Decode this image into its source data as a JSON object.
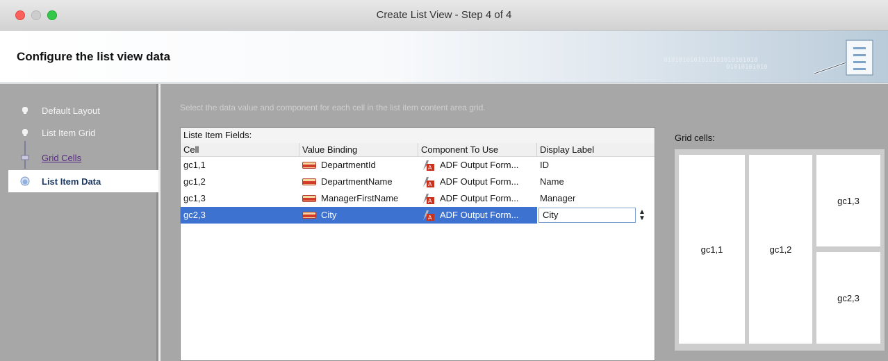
{
  "window": {
    "title": "Create List View - Step 4 of 4"
  },
  "header": {
    "title": "Configure the list view data",
    "binary_line1": "0101010101010101010101010",
    "binary_line2": "01010101010"
  },
  "steps": [
    {
      "label": "Default Layout",
      "state": "done"
    },
    {
      "label": "List Item Grid",
      "state": "done"
    },
    {
      "label": "Grid Cells",
      "state": "link"
    },
    {
      "label": "List Item Data",
      "state": "current"
    }
  ],
  "main": {
    "instructions": "Select the data value and component for each cell in the list item content area grid.",
    "fields_label": "Liste Item Fields:",
    "columns": [
      "Cell",
      "Value Binding",
      "Component To Use",
      "Display Label"
    ],
    "rows": [
      {
        "cell": "gc1,1",
        "binding": "DepartmentId",
        "component": "ADF Output Form...",
        "label": "ID"
      },
      {
        "cell": "gc1,2",
        "binding": "DepartmentName",
        "component": "ADF Output Form...",
        "label": "Name"
      },
      {
        "cell": "gc1,3",
        "binding": "ManagerFirstName",
        "component": "ADF Output Form...",
        "label": "Manager"
      },
      {
        "cell": "gc2,3",
        "binding": "City",
        "component": "ADF Output Form...",
        "label": "City"
      }
    ],
    "spinner_up": "▲",
    "spinner_down": "▼"
  },
  "grid": {
    "label": "Grid cells:",
    "cells": [
      "gc1,1",
      "gc1,2",
      "gc1,3",
      "gc2,3"
    ]
  }
}
